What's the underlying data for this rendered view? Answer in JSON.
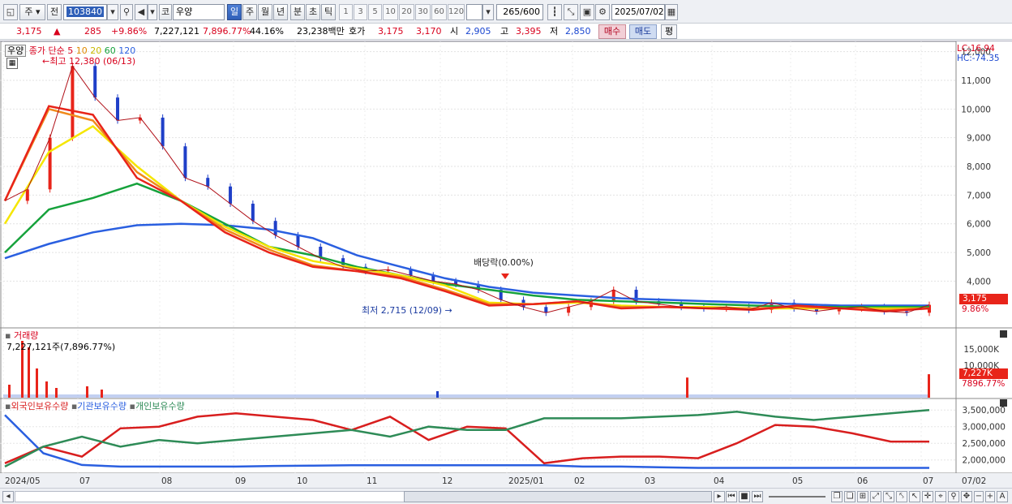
{
  "toolbar": {
    "market_label": "주",
    "range_label": "전",
    "code_value": "103840",
    "search_icon": "magnifier-icon",
    "sound_icon": "speaker-icon",
    "market_type": "코",
    "stock_name": "우양",
    "period_tabs": [
      "일",
      "주",
      "월",
      "년",
      "분",
      "초",
      "틱"
    ],
    "active_period": "일",
    "intervals": [
      "1",
      "3",
      "5",
      "10",
      "20",
      "30",
      "60",
      "120"
    ],
    "count_value": "265",
    "count_total": "/600",
    "date_value": "2025/07/02"
  },
  "quote": {
    "price": "3,175",
    "change_arrow": "▲",
    "change": "285",
    "change_rate": "+9.86%",
    "volume": "7,227,121",
    "volume_rate": "7,896.77%",
    "turnover_rate": "44.16%",
    "trade_value": "23,238백만",
    "ask_label": "호가",
    "ask": "3,175",
    "bid": "3,170",
    "open_label": "시",
    "open": "2,905",
    "high_label": "고",
    "high": "3,395",
    "low_label": "저",
    "low": "2,850",
    "buy_label": "매수",
    "sell_label": "매도",
    "eval_label": "평"
  },
  "price_panel": {
    "name_tag": "우양",
    "legend_prefix": "종가 단순",
    "ma_periods": [
      "5",
      "10",
      "20",
      "60",
      "120"
    ],
    "ma_colors": [
      "#e8241a",
      "#f08a1c",
      "#f5e600",
      "#16a23c",
      "#2a5fe0"
    ],
    "high_annotation": "최고 12,380 (06/13)",
    "low_annotation": "최저 2,715 (12/09)",
    "dividend_annotation": "배당락(0.00%)",
    "lc_label": "LC:16.94",
    "hc_label": "HC:-74.35",
    "current_tag": "3,175",
    "current_rate_tag": "9.86%"
  },
  "volume_panel": {
    "title": "거래량",
    "summary": "7,227,121주(7,896.77%)",
    "current_tag": "7,227K",
    "current_rate_tag": "7896.77%"
  },
  "holding_panel": {
    "legend": [
      "외국인보유수량",
      "기관보유수량",
      "개인보유수량"
    ],
    "colors": [
      "#d81e1e",
      "#2a5fe0",
      "#2e8b57"
    ]
  },
  "chart_data": [
    {
      "type": "candlestick",
      "title": "",
      "x": [
        "2024/05",
        "07",
        "08",
        "09",
        "10",
        "11",
        "12",
        "2025/01",
        "02",
        "03",
        "04",
        "05",
        "06",
        "07"
      ],
      "y_ticks": [
        "12,000",
        "11,000",
        "10,000",
        "9,000",
        "8,000",
        "7,000",
        "6,000",
        "5,000",
        "4,000"
      ],
      "ylim": [
        2400,
        12300
      ],
      "close_series": [
        [
          "2024/05",
          6800
        ],
        [
          "2024/05",
          7200
        ],
        [
          "2024/05",
          9000
        ],
        [
          "2024/06",
          11500
        ],
        [
          "2024/06",
          10400
        ],
        [
          "2024/06",
          9600
        ],
        [
          "2024/06",
          9700
        ],
        [
          "2024/07",
          8700
        ],
        [
          "2024/07",
          7600
        ],
        [
          "2024/07",
          7300
        ],
        [
          "2024/07",
          6700
        ],
        [
          "2024/08",
          6100
        ],
        [
          "2024/08",
          5600
        ],
        [
          "2024/08",
          5200
        ],
        [
          "2024/09",
          4800
        ],
        [
          "2024/09",
          4500
        ],
        [
          "2024/09",
          4350
        ],
        [
          "2024/10",
          4400
        ],
        [
          "2024/10",
          4200
        ],
        [
          "2024/10",
          4000
        ],
        [
          "2024/11",
          3900
        ],
        [
          "2024/11",
          3700
        ],
        [
          "2024/11",
          3350
        ],
        [
          "2024/12",
          3100
        ],
        [
          "2024/12",
          2900
        ],
        [
          "2024/12",
          3100
        ],
        [
          "2024/12",
          3300
        ],
        [
          "2024/12",
          3700
        ],
        [
          "2025/01",
          3300
        ],
        [
          "2025/01",
          3200
        ],
        [
          "2025/02",
          3100
        ],
        [
          "2025/02",
          3050
        ],
        [
          "2025/03",
          3100
        ],
        [
          "2025/03",
          3000
        ],
        [
          "2025/03",
          3250
        ],
        [
          "2025/04",
          3050
        ],
        [
          "2025/04",
          2950
        ],
        [
          "2025/05",
          3050
        ],
        [
          "2025/05",
          3100
        ],
        [
          "2025/06",
          2950
        ],
        [
          "2025/06",
          2900
        ],
        [
          "2025/07",
          3175
        ]
      ],
      "moving_averages": {
        "5": [
          6800,
          10100,
          9800,
          7600,
          6800,
          5700,
          5000,
          4500,
          4350,
          4100,
          3650,
          3150,
          3200,
          3300,
          3050,
          3100,
          3050,
          3000,
          3150,
          3050,
          2950,
          3050
        ],
        "10": [
          6800,
          10000,
          9600,
          7800,
          6800,
          5800,
          5100,
          4550,
          4350,
          4150,
          3700,
          3200,
          3200,
          3300,
          3100,
          3100,
          3050,
          3050,
          3100,
          3050,
          3000,
          3050
        ],
        "20": [
          6000,
          8500,
          9400,
          8000,
          6800,
          5900,
          5200,
          4700,
          4450,
          4200,
          3850,
          3250,
          3200,
          3250,
          3150,
          3100,
          3100,
          3050,
          3050,
          3050,
          3050,
          3050
        ],
        "60": [
          5000,
          6500,
          6900,
          7400,
          6800,
          6000,
          5200,
          4900,
          4500,
          4200,
          3900,
          3700,
          3500,
          3350,
          3300,
          3250,
          3200,
          3150,
          3100,
          3100,
          3100,
          3100
        ],
        "120": [
          4800,
          5300,
          5700,
          5950,
          6000,
          5950,
          5800,
          5500,
          4900,
          4500,
          4100,
          3800,
          3600,
          3500,
          3400,
          3350,
          3300,
          3250,
          3200,
          3150,
          3150,
          3150
        ]
      }
    },
    {
      "type": "bar",
      "title": "거래량",
      "y_ticks": [
        "15,000K",
        "10,000K"
      ],
      "ylim": [
        0,
        19000
      ],
      "spikes": [
        [
          "2024/05",
          4000
        ],
        [
          "2024/05",
          17500
        ],
        [
          "2024/05",
          15500
        ],
        [
          "2024/06",
          9000
        ],
        [
          "2024/06",
          5000
        ],
        [
          "2024/06",
          3000
        ],
        [
          "2024/07",
          3500
        ],
        [
          "2024/07",
          2500
        ],
        [
          "2024/12",
          2000
        ],
        [
          "2025/03",
          6200
        ],
        [
          "2025/07",
          7227
        ]
      ]
    },
    {
      "type": "line",
      "title": "",
      "y_ticks": [
        "3,500,000",
        "3,000,000",
        "2,500,000",
        "2,000,000"
      ],
      "ylim": [
        1700000,
        3700000
      ],
      "series": [
        {
          "name": "외국인보유수량",
          "values": [
            1900000,
            2400000,
            2100000,
            2950000,
            3000000,
            3300000,
            3400000,
            3300000,
            3200000,
            2900000,
            3300000,
            2600000,
            3000000,
            2950000,
            1900000,
            2050000,
            2100000,
            2100000,
            2050000,
            2500000,
            3050000,
            3000000,
            2800000,
            2550000,
            2550000
          ]
        },
        {
          "name": "기관보유수량",
          "values": [
            3350000,
            2200000,
            1850000,
            1800000,
            1800000,
            1800000,
            1800000,
            1820000,
            1830000,
            1840000,
            1840000,
            1840000,
            1840000,
            1840000,
            1840000,
            1800000,
            1800000,
            1780000,
            1760000,
            1760000,
            1760000,
            1760000,
            1760000,
            1760000,
            1760000
          ]
        },
        {
          "name": "개인보유수량",
          "values": [
            1800000,
            2400000,
            2700000,
            2400000,
            2600000,
            2500000,
            2600000,
            2700000,
            2800000,
            2900000,
            2700000,
            3000000,
            2900000,
            2900000,
            3250000,
            3250000,
            3250000,
            3300000,
            3350000,
            3450000,
            3300000,
            3200000,
            3300000,
            3400000,
            3500000
          ]
        }
      ]
    }
  ]
}
